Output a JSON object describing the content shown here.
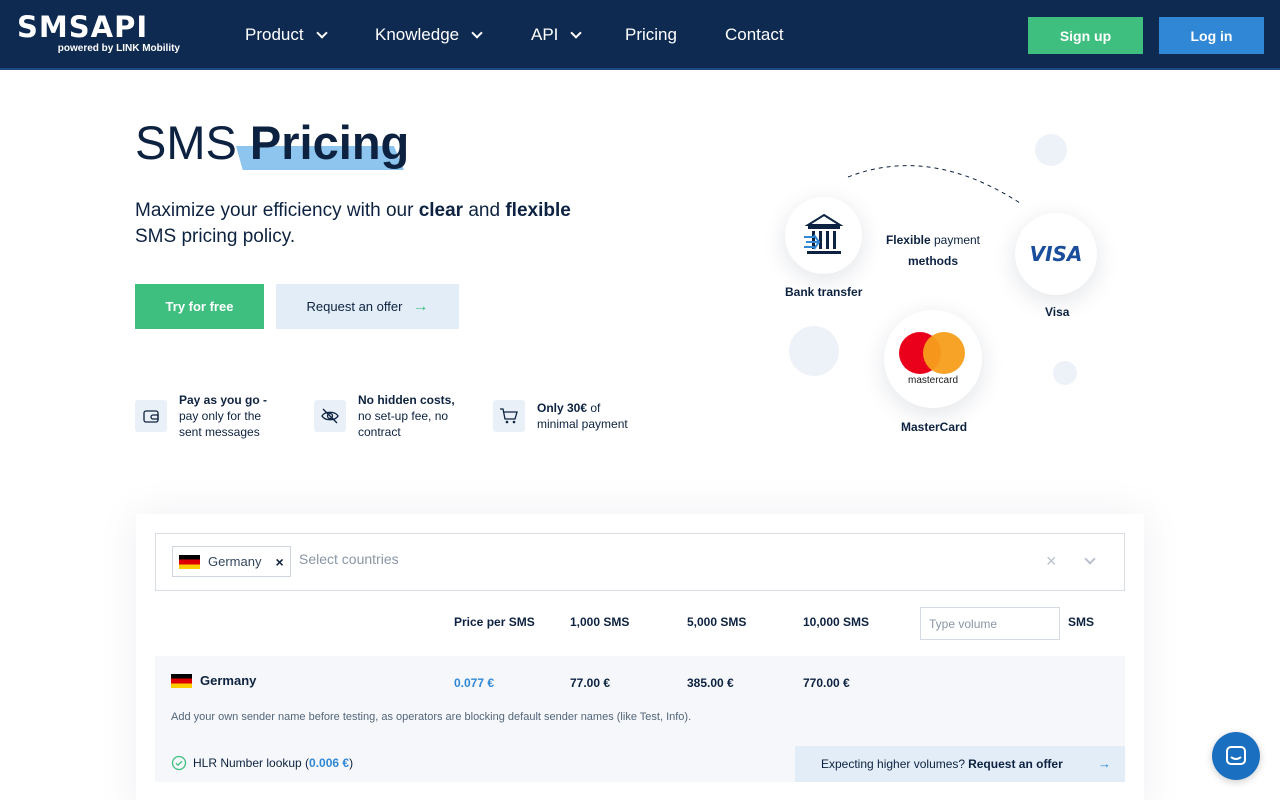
{
  "header": {
    "logo_text": "SMSAPI",
    "logo_sub": "powered by LINK Mobility",
    "nav": [
      {
        "label": "Product",
        "dropdown": true
      },
      {
        "label": "Knowledge",
        "dropdown": true
      },
      {
        "label": "API",
        "dropdown": true
      },
      {
        "label": "Pricing",
        "dropdown": false
      },
      {
        "label": "Contact",
        "dropdown": false
      }
    ],
    "signup_label": "Sign up",
    "login_label": "Log in"
  },
  "hero": {
    "title_light": "SMS",
    "title_bold": "Pricing",
    "subtitle_pre": "Maximize your efficiency with our ",
    "subtitle_b1": "clear",
    "subtitle_mid": " and ",
    "subtitle_b2": "flexible",
    "subtitle_post": "SMS pricing policy.",
    "try_label": "Try for free",
    "offer_label": "Request an offer"
  },
  "features": [
    {
      "icon": "wallet-icon",
      "bold": "Pay as you go -",
      "text1": "pay only for the",
      "text2": "sent messages"
    },
    {
      "icon": "eye-off-icon",
      "bold": "No hidden costs,",
      "text1": "no set-up fee, no",
      "text2": "contract"
    },
    {
      "icon": "cart-icon",
      "bold": "Only 30€",
      "text1": " of",
      "text2": "minimal payment"
    }
  ],
  "payment": {
    "center_bold": "Flexible",
    "center_rest": " payment",
    "center_line2": "methods",
    "bank_label": "Bank transfer",
    "visa_label": "Visa",
    "visa_logo": "VISA",
    "mc_label": "MasterCard",
    "mc_logo": "mastercard"
  },
  "pricing": {
    "selected_country": "Germany",
    "placeholder": "Select countries",
    "columns": [
      "Price per SMS",
      "1,000 SMS",
      "5,000 SMS",
      "10,000 SMS"
    ],
    "volume_placeholder": "Type volume",
    "volume_unit": "SMS",
    "row": {
      "country": "Germany",
      "price": "0.077 €",
      "v1000": "77.00 €",
      "v5000": "385.00 €",
      "v10000": "770.00 €"
    },
    "note": "Add your own sender name before testing, as operators are blocking default sender names (like Test, Info).",
    "hlr_label": "HLR Number lookup (",
    "hlr_price": "0.006 €",
    "hlr_close": ")",
    "higher_text": "Expecting higher volumes?",
    "higher_link": "Request an offer"
  },
  "colors": {
    "navy": "#0e2a50",
    "green": "#3fbf7f",
    "blue": "#2f87d6"
  }
}
